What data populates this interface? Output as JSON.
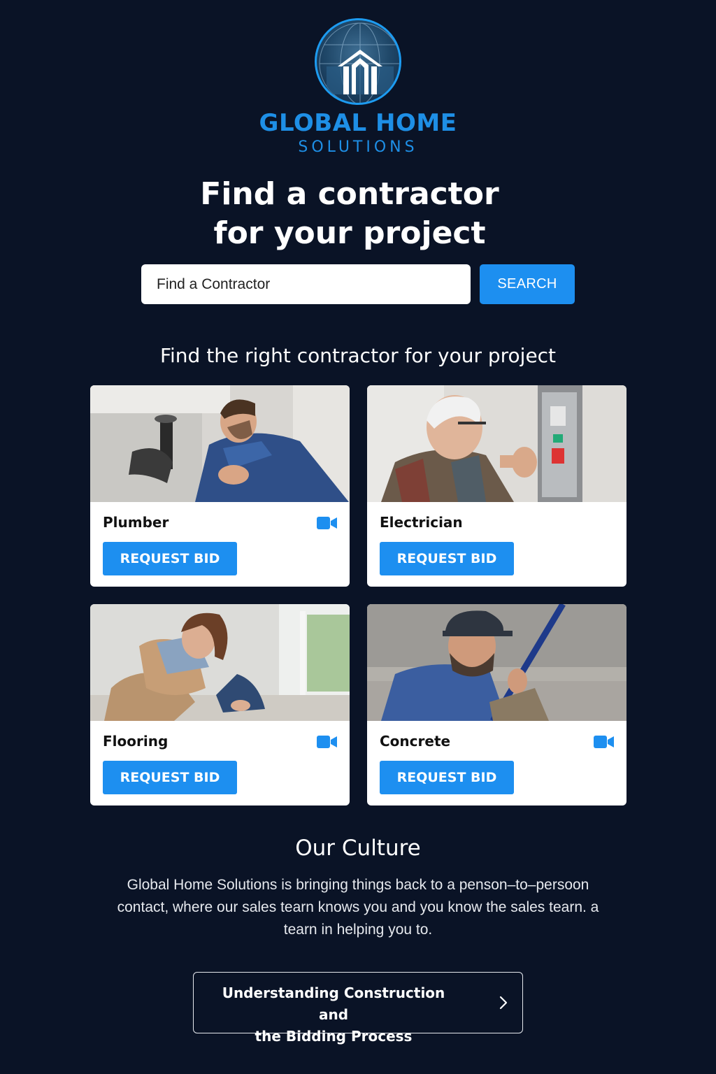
{
  "brand": {
    "title": "GLOBAL HOME",
    "subtitle": "SOLUTIONS",
    "logo_icon": "house-globe-icon",
    "accent_color": "#1e8fe6"
  },
  "hero": {
    "title_line1": "Find a contractor",
    "title_line2": "for your project"
  },
  "search": {
    "placeholder": "Find a Contractor",
    "button_label": "SEARCH"
  },
  "contractors": {
    "heading": "Find the right contractor for your project",
    "items": [
      {
        "name": "Plumber",
        "button_label": "REQUEST BID",
        "has_video": true,
        "photo": "plumber-photo"
      },
      {
        "name": "Electrician",
        "button_label": "REQUEST BID",
        "has_video": false,
        "photo": "electrician-photo"
      },
      {
        "name": "Flooring",
        "button_label": "REQUEST BID",
        "has_video": true,
        "photo": "flooring-photo"
      },
      {
        "name": "Concrete",
        "button_label": "REQUEST BID",
        "has_video": true,
        "photo": "concrete-photo"
      }
    ]
  },
  "culture": {
    "heading": "Our Culture",
    "body": "Global Home Solutions is bringing things back to a penson–to–persoon contact, where our sales tearn knows you and you know the sales tearn. a tearn in helping you to."
  },
  "guide": {
    "label_line1": "Understanding Construction and",
    "label_line2": "the Bidding Process",
    "icon": "chevron-right-icon"
  },
  "colors": {
    "background": "#0a1326",
    "button": "#1d8ff0",
    "card": "#ffffff"
  }
}
